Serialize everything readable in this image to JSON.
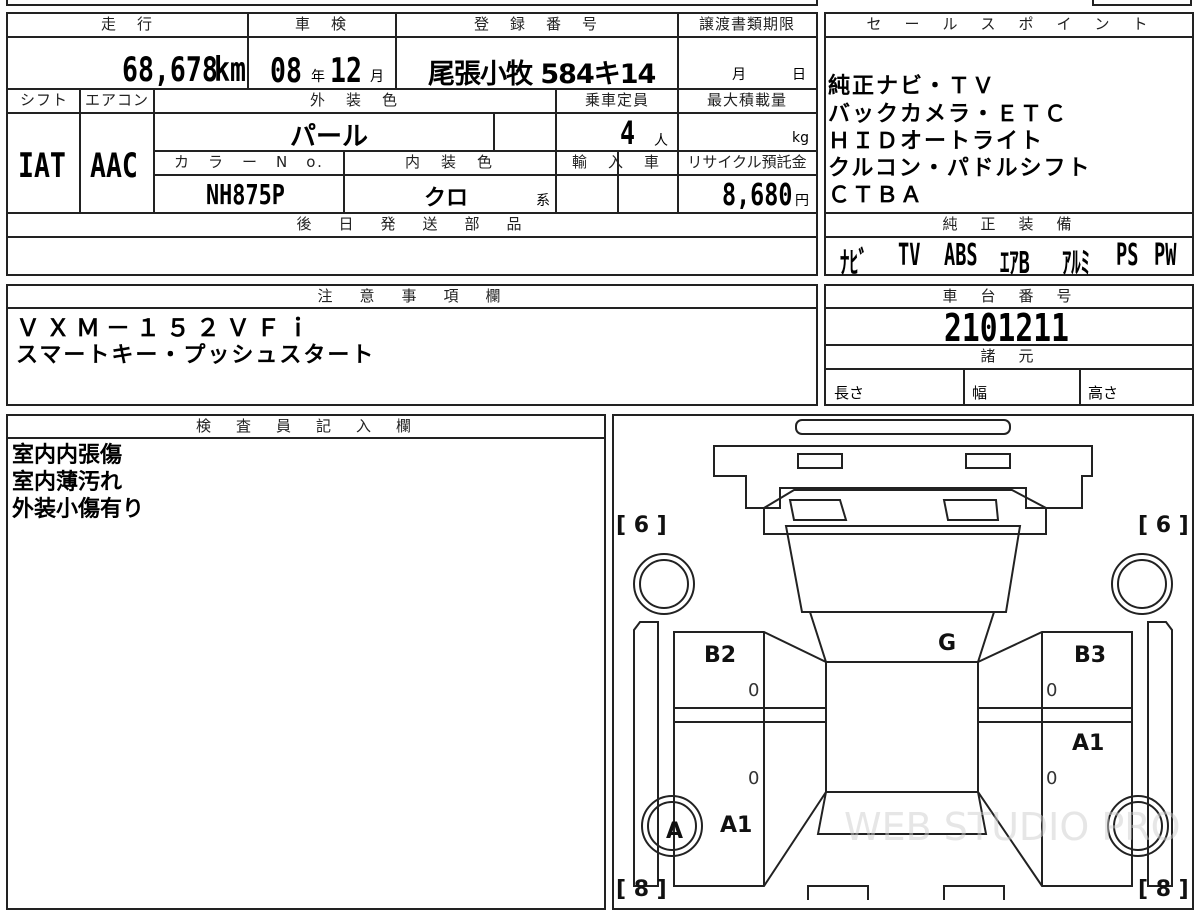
{
  "summary": {
    "mileage": {
      "label": "走　行",
      "value": "68,678",
      "unit": "km"
    },
    "inspection": {
      "label": "車　検",
      "year": "08",
      "year_unit": "年",
      "month": "12",
      "month_unit": "月"
    },
    "registration": {
      "label": "登　録　番　号",
      "value": "尾張小牧 584キ14"
    },
    "transfer_deadline": {
      "label": "譲渡書類期限",
      "month_unit": "月",
      "day_unit": "日"
    },
    "shift": {
      "label": "シフト",
      "value": "IAT"
    },
    "aircon": {
      "label": "エアコン",
      "value": "AAC"
    },
    "exterior_color": {
      "label": "外　装　色",
      "value": "パール"
    },
    "capacity": {
      "label": "乗車定員",
      "value": "4",
      "unit": "人"
    },
    "max_load": {
      "label": "最大積載量",
      "unit": "kg"
    },
    "color_no": {
      "label": "カ　ラ　ー　N　o.",
      "value": "NH875P"
    },
    "interior_color": {
      "label": "内　装　色",
      "value": "クロ",
      "unit": "系"
    },
    "import": {
      "label": "輸　入　車"
    },
    "recycle": {
      "label": "リサイクル預託金",
      "value": "8,680",
      "unit": "円"
    },
    "later_parts": {
      "label": "後　日　発　送　部　品"
    }
  },
  "sales_points": {
    "label": "セ　ー　ル　ス　ポ　イ　ン　ト",
    "lines": [
      "純正ナビ・ＴＶ",
      "バックカメラ・ＥＴＣ",
      "ＨＩＤオートライト",
      "クルコン・パドルシフト",
      "ＣＴＢＡ"
    ]
  },
  "equipment": {
    "label": "純　正　装　備",
    "items": [
      "ﾅﾋﾞ",
      "TV",
      "ABS",
      "ｴｱB",
      "ｱﾙﾐ",
      "PS",
      "PW"
    ]
  },
  "caution": {
    "label": "注　意　事　項　欄",
    "lines": [
      "ＶＸＭ－１５２ＶＦｉ",
      "スマートキー・プッシュスタート"
    ]
  },
  "chassis": {
    "label": "車　台　番　号",
    "value": "2101211"
  },
  "specs": {
    "label": "諸　元",
    "length": "長さ",
    "width": "幅",
    "height": "高さ"
  },
  "inspector": {
    "label": "検　査　員　記　入　欄",
    "lines": [
      "室内内張傷",
      "室内薄汚れ",
      "外装小傷有り"
    ]
  },
  "diagram": {
    "tire_fl": "[ 6 ]",
    "tire_fr": "[ 6 ]",
    "tire_rl": "[ 8 ]",
    "tire_rr": "[ 8 ]",
    "mark_b2": "B2",
    "mark_b3": "B3",
    "mark_g": "G",
    "mark_a1_right": "A1",
    "mark_a1_left": "A1",
    "mark_a": "A",
    "zero": "0",
    "watermark": "WEB STUDIO PRO"
  }
}
